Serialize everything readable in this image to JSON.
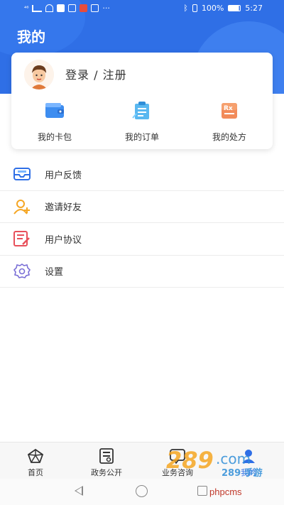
{
  "status_bar": {
    "signal_text": "⁴⁶",
    "battery": "100%",
    "time": "5:27"
  },
  "header": {
    "title": "我的"
  },
  "user_card": {
    "login_label": "登录 / 注册",
    "quick_actions": [
      {
        "label": "我的卡包",
        "icon": "wallet-icon"
      },
      {
        "label": "我的订单",
        "icon": "order-clipboard-icon"
      },
      {
        "label": "我的处方",
        "icon": "prescription-rx-icon"
      }
    ]
  },
  "menu": {
    "items": [
      {
        "label": "用户反馈",
        "icon": "feedback-mail-icon"
      },
      {
        "label": "邀请好友",
        "icon": "invite-friend-icon"
      },
      {
        "label": "用户协议",
        "icon": "agreement-doc-icon"
      },
      {
        "label": "设置",
        "icon": "settings-gear-icon"
      }
    ]
  },
  "bottom_nav": {
    "items": [
      {
        "label": "首页",
        "icon": "home-icon"
      },
      {
        "label": "政务公开",
        "icon": "public-affairs-icon"
      },
      {
        "label": "业务咨询",
        "icon": "consult-icon"
      },
      {
        "label": "我的",
        "icon": "profile-icon"
      }
    ]
  },
  "watermark": {
    "brand": "289 手游网",
    "site": "phpcms"
  },
  "colors": {
    "primary": "#2f6fe6",
    "accent_orange": "#f5a623",
    "accent_red": "#e8505b"
  }
}
